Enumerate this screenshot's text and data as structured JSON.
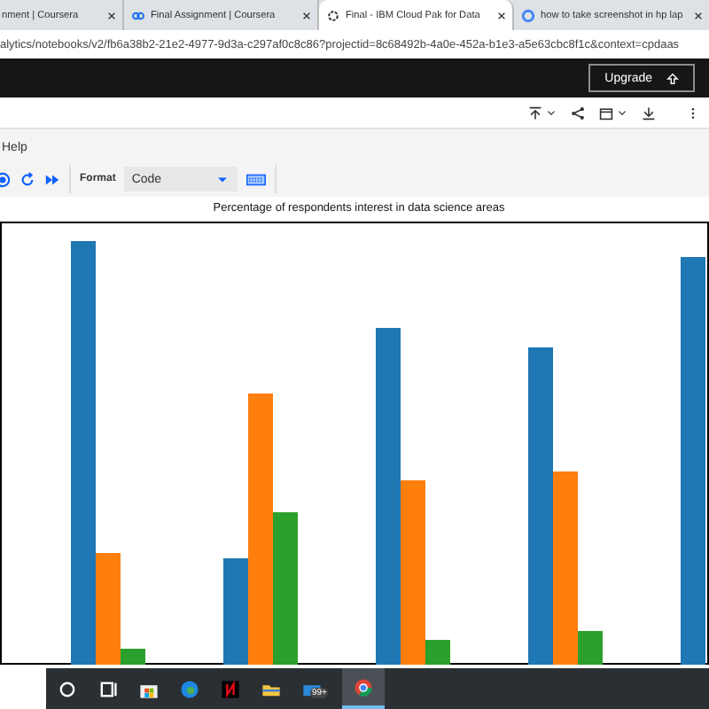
{
  "browser_tabs": [
    {
      "title": "nment | Coursera",
      "selected": false
    },
    {
      "title": "Final Assignment | Coursera",
      "selected": false
    },
    {
      "title": "Final - IBM Cloud Pak for Data",
      "selected": true
    },
    {
      "title": "how to take screenshot in hp lap",
      "selected": false
    }
  ],
  "address_bar": {
    "url": "alytics/notebooks/v2/fb6a38b2-21e2-4977-9d3a-c297af0c8c86?projectid=8c68492b-4a0e-452a-b1e3-a5e63cbc8f1c&context=cpdaas"
  },
  "header": {
    "upgrade_button": "Upgrade"
  },
  "menu": {
    "items": [
      "Help"
    ]
  },
  "notebook_toolbar": {
    "format_label": "Format",
    "format_value": "Code"
  },
  "chart": {
    "title": "Percentage of respondents interest in data science areas"
  },
  "taskbar": {
    "mail_badge": "99+"
  }
}
